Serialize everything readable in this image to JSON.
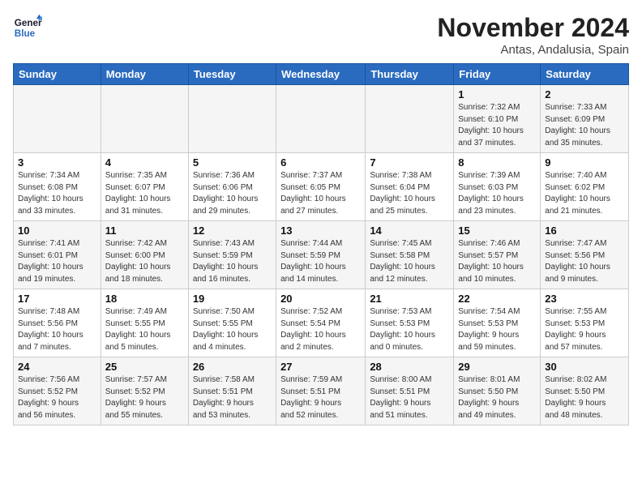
{
  "header": {
    "logo_general": "General",
    "logo_blue": "Blue",
    "month_title": "November 2024",
    "location": "Antas, Andalusia, Spain"
  },
  "weekdays": [
    "Sunday",
    "Monday",
    "Tuesday",
    "Wednesday",
    "Thursday",
    "Friday",
    "Saturday"
  ],
  "weeks": [
    [
      {
        "day": "",
        "info": ""
      },
      {
        "day": "",
        "info": ""
      },
      {
        "day": "",
        "info": ""
      },
      {
        "day": "",
        "info": ""
      },
      {
        "day": "",
        "info": ""
      },
      {
        "day": "1",
        "info": "Sunrise: 7:32 AM\nSunset: 6:10 PM\nDaylight: 10 hours\nand 37 minutes."
      },
      {
        "day": "2",
        "info": "Sunrise: 7:33 AM\nSunset: 6:09 PM\nDaylight: 10 hours\nand 35 minutes."
      }
    ],
    [
      {
        "day": "3",
        "info": "Sunrise: 7:34 AM\nSunset: 6:08 PM\nDaylight: 10 hours\nand 33 minutes."
      },
      {
        "day": "4",
        "info": "Sunrise: 7:35 AM\nSunset: 6:07 PM\nDaylight: 10 hours\nand 31 minutes."
      },
      {
        "day": "5",
        "info": "Sunrise: 7:36 AM\nSunset: 6:06 PM\nDaylight: 10 hours\nand 29 minutes."
      },
      {
        "day": "6",
        "info": "Sunrise: 7:37 AM\nSunset: 6:05 PM\nDaylight: 10 hours\nand 27 minutes."
      },
      {
        "day": "7",
        "info": "Sunrise: 7:38 AM\nSunset: 6:04 PM\nDaylight: 10 hours\nand 25 minutes."
      },
      {
        "day": "8",
        "info": "Sunrise: 7:39 AM\nSunset: 6:03 PM\nDaylight: 10 hours\nand 23 minutes."
      },
      {
        "day": "9",
        "info": "Sunrise: 7:40 AM\nSunset: 6:02 PM\nDaylight: 10 hours\nand 21 minutes."
      }
    ],
    [
      {
        "day": "10",
        "info": "Sunrise: 7:41 AM\nSunset: 6:01 PM\nDaylight: 10 hours\nand 19 minutes."
      },
      {
        "day": "11",
        "info": "Sunrise: 7:42 AM\nSunset: 6:00 PM\nDaylight: 10 hours\nand 18 minutes."
      },
      {
        "day": "12",
        "info": "Sunrise: 7:43 AM\nSunset: 5:59 PM\nDaylight: 10 hours\nand 16 minutes."
      },
      {
        "day": "13",
        "info": "Sunrise: 7:44 AM\nSunset: 5:59 PM\nDaylight: 10 hours\nand 14 minutes."
      },
      {
        "day": "14",
        "info": "Sunrise: 7:45 AM\nSunset: 5:58 PM\nDaylight: 10 hours\nand 12 minutes."
      },
      {
        "day": "15",
        "info": "Sunrise: 7:46 AM\nSunset: 5:57 PM\nDaylight: 10 hours\nand 10 minutes."
      },
      {
        "day": "16",
        "info": "Sunrise: 7:47 AM\nSunset: 5:56 PM\nDaylight: 10 hours\nand 9 minutes."
      }
    ],
    [
      {
        "day": "17",
        "info": "Sunrise: 7:48 AM\nSunset: 5:56 PM\nDaylight: 10 hours\nand 7 minutes."
      },
      {
        "day": "18",
        "info": "Sunrise: 7:49 AM\nSunset: 5:55 PM\nDaylight: 10 hours\nand 5 minutes."
      },
      {
        "day": "19",
        "info": "Sunrise: 7:50 AM\nSunset: 5:55 PM\nDaylight: 10 hours\nand 4 minutes."
      },
      {
        "day": "20",
        "info": "Sunrise: 7:52 AM\nSunset: 5:54 PM\nDaylight: 10 hours\nand 2 minutes."
      },
      {
        "day": "21",
        "info": "Sunrise: 7:53 AM\nSunset: 5:53 PM\nDaylight: 10 hours\nand 0 minutes."
      },
      {
        "day": "22",
        "info": "Sunrise: 7:54 AM\nSunset: 5:53 PM\nDaylight: 9 hours\nand 59 minutes."
      },
      {
        "day": "23",
        "info": "Sunrise: 7:55 AM\nSunset: 5:53 PM\nDaylight: 9 hours\nand 57 minutes."
      }
    ],
    [
      {
        "day": "24",
        "info": "Sunrise: 7:56 AM\nSunset: 5:52 PM\nDaylight: 9 hours\nand 56 minutes."
      },
      {
        "day": "25",
        "info": "Sunrise: 7:57 AM\nSunset: 5:52 PM\nDaylight: 9 hours\nand 55 minutes."
      },
      {
        "day": "26",
        "info": "Sunrise: 7:58 AM\nSunset: 5:51 PM\nDaylight: 9 hours\nand 53 minutes."
      },
      {
        "day": "27",
        "info": "Sunrise: 7:59 AM\nSunset: 5:51 PM\nDaylight: 9 hours\nand 52 minutes."
      },
      {
        "day": "28",
        "info": "Sunrise: 8:00 AM\nSunset: 5:51 PM\nDaylight: 9 hours\nand 51 minutes."
      },
      {
        "day": "29",
        "info": "Sunrise: 8:01 AM\nSunset: 5:50 PM\nDaylight: 9 hours\nand 49 minutes."
      },
      {
        "day": "30",
        "info": "Sunrise: 8:02 AM\nSunset: 5:50 PM\nDaylight: 9 hours\nand 48 minutes."
      }
    ]
  ]
}
